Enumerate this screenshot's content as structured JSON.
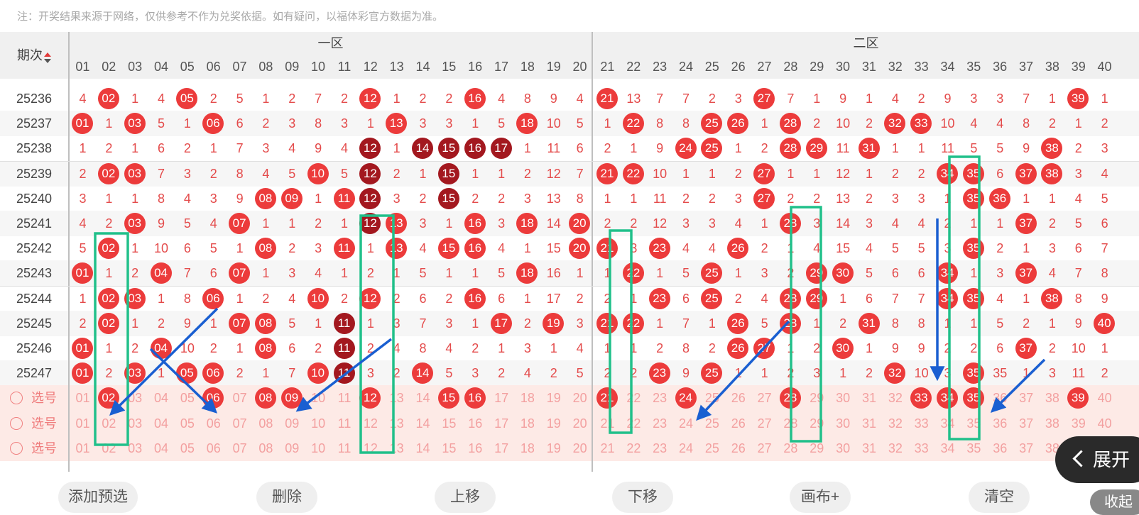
{
  "note": "注：开奖结果来源于网络，仅供参考不作为兑奖依据。如有疑问，以福体彩官方数据为准。",
  "header": {
    "period_label": "期次",
    "zone1_label": "一区",
    "zone2_label": "二区"
  },
  "columns": [
    "01",
    "02",
    "03",
    "04",
    "05",
    "06",
    "07",
    "08",
    "09",
    "10",
    "11",
    "12",
    "13",
    "14",
    "15",
    "16",
    "17",
    "18",
    "19",
    "20",
    "21",
    "22",
    "23",
    "24",
    "25",
    "26",
    "27",
    "28",
    "29",
    "30",
    "31",
    "32",
    "33",
    "34",
    "35",
    "36",
    "37",
    "38",
    "39",
    "40"
  ],
  "draws": [
    {
      "period": "25236",
      "cells": [
        "4",
        "02",
        "1",
        "4",
        "05",
        "2",
        "5",
        "1",
        "2",
        "7",
        "2",
        "12",
        "1",
        "2",
        "2",
        "16",
        "4",
        "8",
        "9",
        "4",
        "21",
        "13",
        "7",
        "7",
        "2",
        "3",
        "27",
        "7",
        "1",
        "9",
        "1",
        "4",
        "2",
        "9",
        "3",
        "3",
        "7",
        "1",
        "39",
        "1"
      ]
    },
    {
      "period": "25237",
      "cells": [
        "01",
        "1",
        "03",
        "5",
        "1",
        "06",
        "6",
        "2",
        "3",
        "8",
        "3",
        "1",
        "13",
        "3",
        "3",
        "1",
        "5",
        "18",
        "10",
        "5",
        "1",
        "22",
        "8",
        "8",
        "25",
        "26",
        "1",
        "28",
        "2",
        "10",
        "2",
        "32",
        "33",
        "10",
        "4",
        "4",
        "8",
        "2",
        "1",
        "2"
      ]
    },
    {
      "period": "25238",
      "cells": [
        "1",
        "2",
        "1",
        "6",
        "2",
        "1",
        "7",
        "3",
        "4",
        "9",
        "4",
        "12",
        "1",
        "14",
        "15",
        "16",
        "17",
        "1",
        "11",
        "6",
        "2",
        "1",
        "9",
        "24",
        "25",
        "1",
        "2",
        "28",
        "29",
        "11",
        "31",
        "1",
        "1",
        "11",
        "5",
        "5",
        "9",
        "38",
        "2",
        "3"
      ]
    },
    {
      "period": "25239",
      "cells": [
        "2",
        "02",
        "03",
        "7",
        "3",
        "2",
        "8",
        "4",
        "5",
        "10",
        "5",
        "12",
        "2",
        "1",
        "15",
        "1",
        "1",
        "2",
        "12",
        "7",
        "21",
        "22",
        "10",
        "1",
        "1",
        "2",
        "27",
        "1",
        "1",
        "12",
        "1",
        "2",
        "2",
        "34",
        "35",
        "6",
        "37",
        "38",
        "3",
        "4"
      ]
    },
    {
      "period": "25240",
      "cells": [
        "3",
        "1",
        "1",
        "8",
        "4",
        "3",
        "9",
        "08",
        "09",
        "1",
        "11",
        "12",
        "3",
        "2",
        "15",
        "2",
        "2",
        "3",
        "13",
        "8",
        "1",
        "1",
        "11",
        "2",
        "2",
        "3",
        "27",
        "2",
        "2",
        "13",
        "2",
        "3",
        "3",
        "1",
        "35",
        "36",
        "1",
        "1",
        "4",
        "5"
      ]
    },
    {
      "period": "25241",
      "cells": [
        "4",
        "2",
        "03",
        "9",
        "5",
        "4",
        "07",
        "1",
        "1",
        "2",
        "1",
        "12",
        "13",
        "3",
        "1",
        "16",
        "3",
        "18",
        "14",
        "20",
        "2",
        "2",
        "12",
        "3",
        "3",
        "4",
        "1",
        "28",
        "3",
        "14",
        "3",
        "4",
        "4",
        "2",
        "1",
        "1",
        "37",
        "2",
        "5",
        "6"
      ]
    },
    {
      "period": "25242",
      "cells": [
        "5",
        "02",
        "1",
        "10",
        "6",
        "5",
        "1",
        "08",
        "2",
        "3",
        "11",
        "1",
        "13",
        "4",
        "15",
        "16",
        "4",
        "1",
        "15",
        "20",
        "21",
        "3",
        "23",
        "4",
        "4",
        "26",
        "2",
        "1",
        "4",
        "15",
        "4",
        "5",
        "5",
        "3",
        "35",
        "2",
        "1",
        "3",
        "6",
        "7"
      ]
    },
    {
      "period": "25243",
      "cells": [
        "01",
        "1",
        "2",
        "04",
        "7",
        "6",
        "07",
        "1",
        "3",
        "4",
        "1",
        "2",
        "1",
        "5",
        "1",
        "1",
        "5",
        "18",
        "16",
        "1",
        "1",
        "22",
        "1",
        "5",
        "25",
        "1",
        "3",
        "2",
        "29",
        "30",
        "5",
        "6",
        "6",
        "34",
        "1",
        "3",
        "37",
        "4",
        "7",
        "8"
      ]
    },
    {
      "period": "25244",
      "cells": [
        "1",
        "02",
        "03",
        "1",
        "8",
        "06",
        "1",
        "2",
        "4",
        "10",
        "2",
        "12",
        "2",
        "6",
        "2",
        "16",
        "6",
        "1",
        "17",
        "2",
        "2",
        "1",
        "23",
        "6",
        "25",
        "2",
        "4",
        "28",
        "29",
        "1",
        "6",
        "7",
        "7",
        "34",
        "35",
        "4",
        "1",
        "38",
        "8",
        "9"
      ]
    },
    {
      "period": "25245",
      "cells": [
        "2",
        "02",
        "1",
        "2",
        "9",
        "1",
        "07",
        "08",
        "5",
        "1",
        "11",
        "1",
        "3",
        "7",
        "3",
        "1",
        "17",
        "2",
        "19",
        "3",
        "21",
        "22",
        "1",
        "7",
        "1",
        "26",
        "5",
        "28",
        "1",
        "2",
        "31",
        "8",
        "8",
        "1",
        "1",
        "5",
        "2",
        "1",
        "9",
        "40"
      ]
    },
    {
      "period": "25246",
      "cells": [
        "01",
        "1",
        "2",
        "04",
        "10",
        "2",
        "1",
        "08",
        "6",
        "2",
        "11",
        "2",
        "4",
        "8",
        "4",
        "2",
        "1",
        "3",
        "1",
        "4",
        "1",
        "1",
        "2",
        "8",
        "2",
        "26",
        "27",
        "1",
        "2",
        "30",
        "1",
        "9",
        "9",
        "2",
        "2",
        "6",
        "37",
        "2",
        "10",
        "1"
      ]
    },
    {
      "period": "25247",
      "cells": [
        "01",
        "2",
        "03",
        "1",
        "05",
        "06",
        "2",
        "1",
        "7",
        "10",
        "11",
        "3",
        "2",
        "14",
        "5",
        "3",
        "2",
        "4",
        "2",
        "5",
        "2",
        "2",
        "23",
        "9",
        "25",
        "1",
        "1",
        "2",
        "3",
        "1",
        "2",
        "32",
        "10",
        "3",
        "35",
        "35",
        "1",
        "3",
        "11",
        "2"
      ]
    }
  ],
  "dark_balls": [
    [
      2,
      11
    ],
    [
      2,
      13
    ],
    [
      2,
      14
    ],
    [
      2,
      15
    ],
    [
      2,
      16
    ],
    [
      3,
      11
    ],
    [
      3,
      14
    ],
    [
      4,
      11
    ],
    [
      4,
      14
    ],
    [
      5,
      11
    ],
    [
      9,
      10
    ],
    [
      10,
      10
    ],
    [
      11,
      10
    ]
  ],
  "picks": [
    {
      "label": "选号",
      "selected": [
        "02",
        "06",
        "08",
        "09",
        "12",
        "15",
        "16",
        "21",
        "24",
        "28",
        "33",
        "34",
        "35",
        "39"
      ]
    },
    {
      "label": "选号",
      "selected": []
    },
    {
      "label": "选号",
      "selected": []
    }
  ],
  "toolbar": [
    "添加预选",
    "删除",
    "上移",
    "下移",
    "画布+",
    "清空"
  ],
  "expand_label": "展开",
  "collapse_label": "收起",
  "colors": {
    "ball": "#ec3b3b",
    "ball_dark": "#a3181f",
    "miss_text": "#e44b4b",
    "highlight_box": "#20c08a",
    "arrow": "#1a5fd1"
  }
}
